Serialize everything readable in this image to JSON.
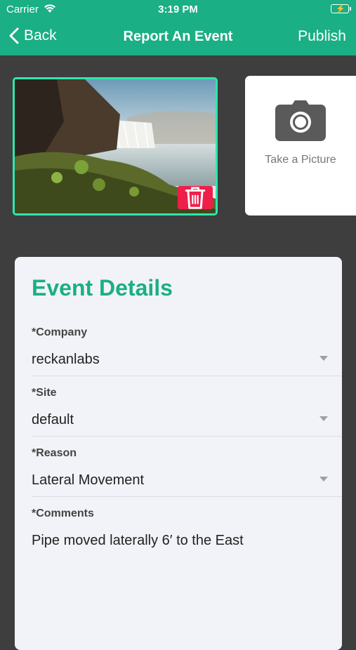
{
  "status_bar": {
    "carrier": "Carrier",
    "time": "3:19 PM"
  },
  "nav": {
    "back_label": "Back",
    "title": "Report An Event",
    "publish_label": "Publish"
  },
  "media": {
    "take_picture_label": "Take a Picture"
  },
  "details": {
    "title": "Event Details",
    "company": {
      "label": "*Company",
      "value": "reckanlabs"
    },
    "site": {
      "label": "*Site",
      "value": "default"
    },
    "reason": {
      "label": "*Reason",
      "value": "Lateral Movement"
    },
    "comments": {
      "label": "*Comments",
      "value": "Pipe moved laterally 6′ to the East"
    }
  },
  "colors": {
    "accent": "#1aaf84",
    "delete": "#ee1f4b",
    "background": "#3e3e3e",
    "photo_border": "#2fe6b0"
  }
}
